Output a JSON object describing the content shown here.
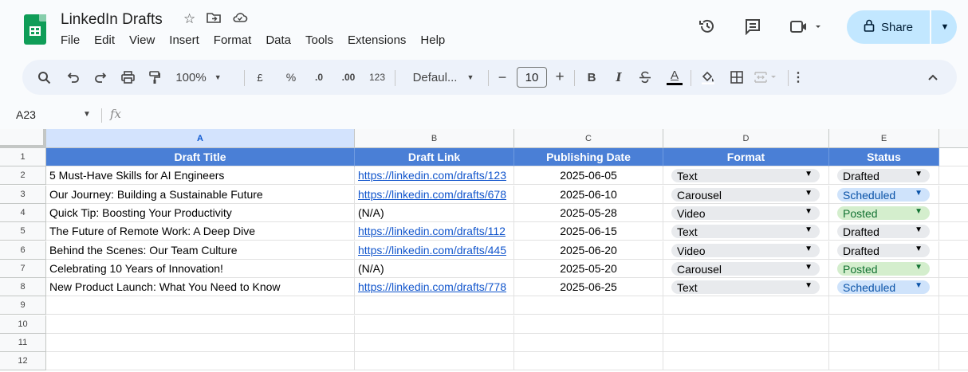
{
  "app": {
    "doc_title": "LinkedIn Drafts",
    "menu": [
      "File",
      "Edit",
      "View",
      "Insert",
      "Format",
      "Data",
      "Tools",
      "Extensions",
      "Help"
    ],
    "share_label": "Share"
  },
  "toolbar": {
    "zoom": "100%",
    "currency": "£",
    "percent": "%",
    "decrease_decimal": ".0",
    "increase_decimal": ".00",
    "number_format": "123",
    "font": "Defaul...",
    "font_size": "10",
    "minus": "−",
    "plus": "+",
    "bold": "B",
    "italic": "I",
    "text_color": "A"
  },
  "formula_bar": {
    "name_box": "A23",
    "fx": "fx",
    "content": ""
  },
  "columns": [
    "A",
    "B",
    "C",
    "D",
    "E"
  ],
  "row_numbers": [
    "1",
    "2",
    "3",
    "4",
    "5",
    "6",
    "7",
    "8",
    "9",
    "10",
    "11",
    "12"
  ],
  "headers": {
    "title": "Draft Title",
    "link": "Draft Link",
    "date": "Publishing Date",
    "format": "Format",
    "status": "Status"
  },
  "rows": [
    {
      "title": "5 Must-Have Skills for AI Engineers",
      "link": "https://linkedin.com/drafts/123",
      "date": "2025-06-05",
      "format": "Text",
      "status": "Drafted"
    },
    {
      "title": "Our Journey: Building a Sustainable Future",
      "link": "https://linkedin.com/drafts/678",
      "date": "2025-06-10",
      "format": "Carousel",
      "status": "Scheduled"
    },
    {
      "title": "Quick Tip: Boosting Your Productivity",
      "link": "(N/A)",
      "date": "2025-05-28",
      "format": "Video",
      "status": "Posted"
    },
    {
      "title": "The Future of Remote Work: A Deep Dive",
      "link": "https://linkedin.com/drafts/112",
      "date": "2025-06-15",
      "format": "Text",
      "status": "Drafted"
    },
    {
      "title": "Behind the Scenes: Our Team Culture",
      "link": "https://linkedin.com/drafts/445",
      "date": "2025-06-20",
      "format": "Video",
      "status": "Drafted"
    },
    {
      "title": "Celebrating 10 Years of Innovation!",
      "link": "(N/A)",
      "date": "2025-05-20",
      "format": "Carousel",
      "status": "Posted"
    },
    {
      "title": "New Product Launch: What You Need to Know",
      "link": "https://linkedin.com/drafts/778",
      "date": "2025-06-25",
      "format": "Text",
      "status": "Scheduled"
    }
  ],
  "colors": {
    "header_fill": "#4a7fd6",
    "status_drafted": "#e8eaed",
    "status_scheduled": "#cfe3fb",
    "status_posted": "#d4eecd",
    "share_button": "#c2e7ff"
  }
}
